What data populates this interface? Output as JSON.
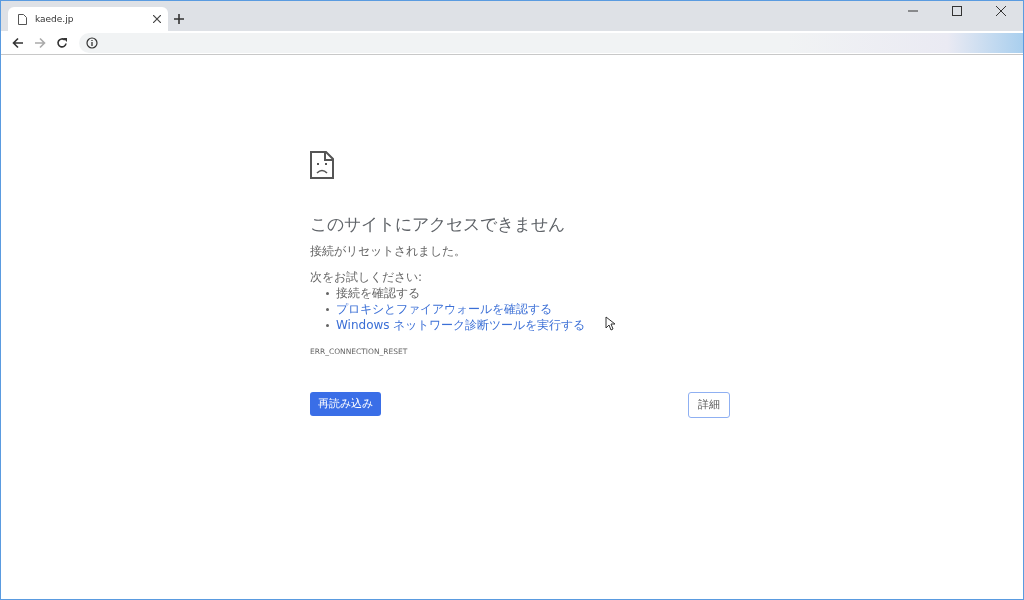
{
  "tabs": [
    {
      "title": "kaede.jp",
      "selected": true
    }
  ],
  "toolbar": {
    "back_disabled": false,
    "forward_disabled": true
  },
  "error": {
    "heading": "このサイトにアクセスできません",
    "message": "接続がリセットされました。",
    "suggestions_intro": "次をお試しください:",
    "suggestions": [
      {
        "kind": "text",
        "text": "接続を確認する"
      },
      {
        "kind": "link",
        "text": "プロキシとファイアウォールを確認する"
      },
      {
        "kind": "link",
        "text": "Windows ネットワーク診断ツールを実行する"
      }
    ],
    "code": "ERR_CONNECTION_RESET",
    "reload_button": "再読み込み",
    "details_button": "詳細"
  }
}
